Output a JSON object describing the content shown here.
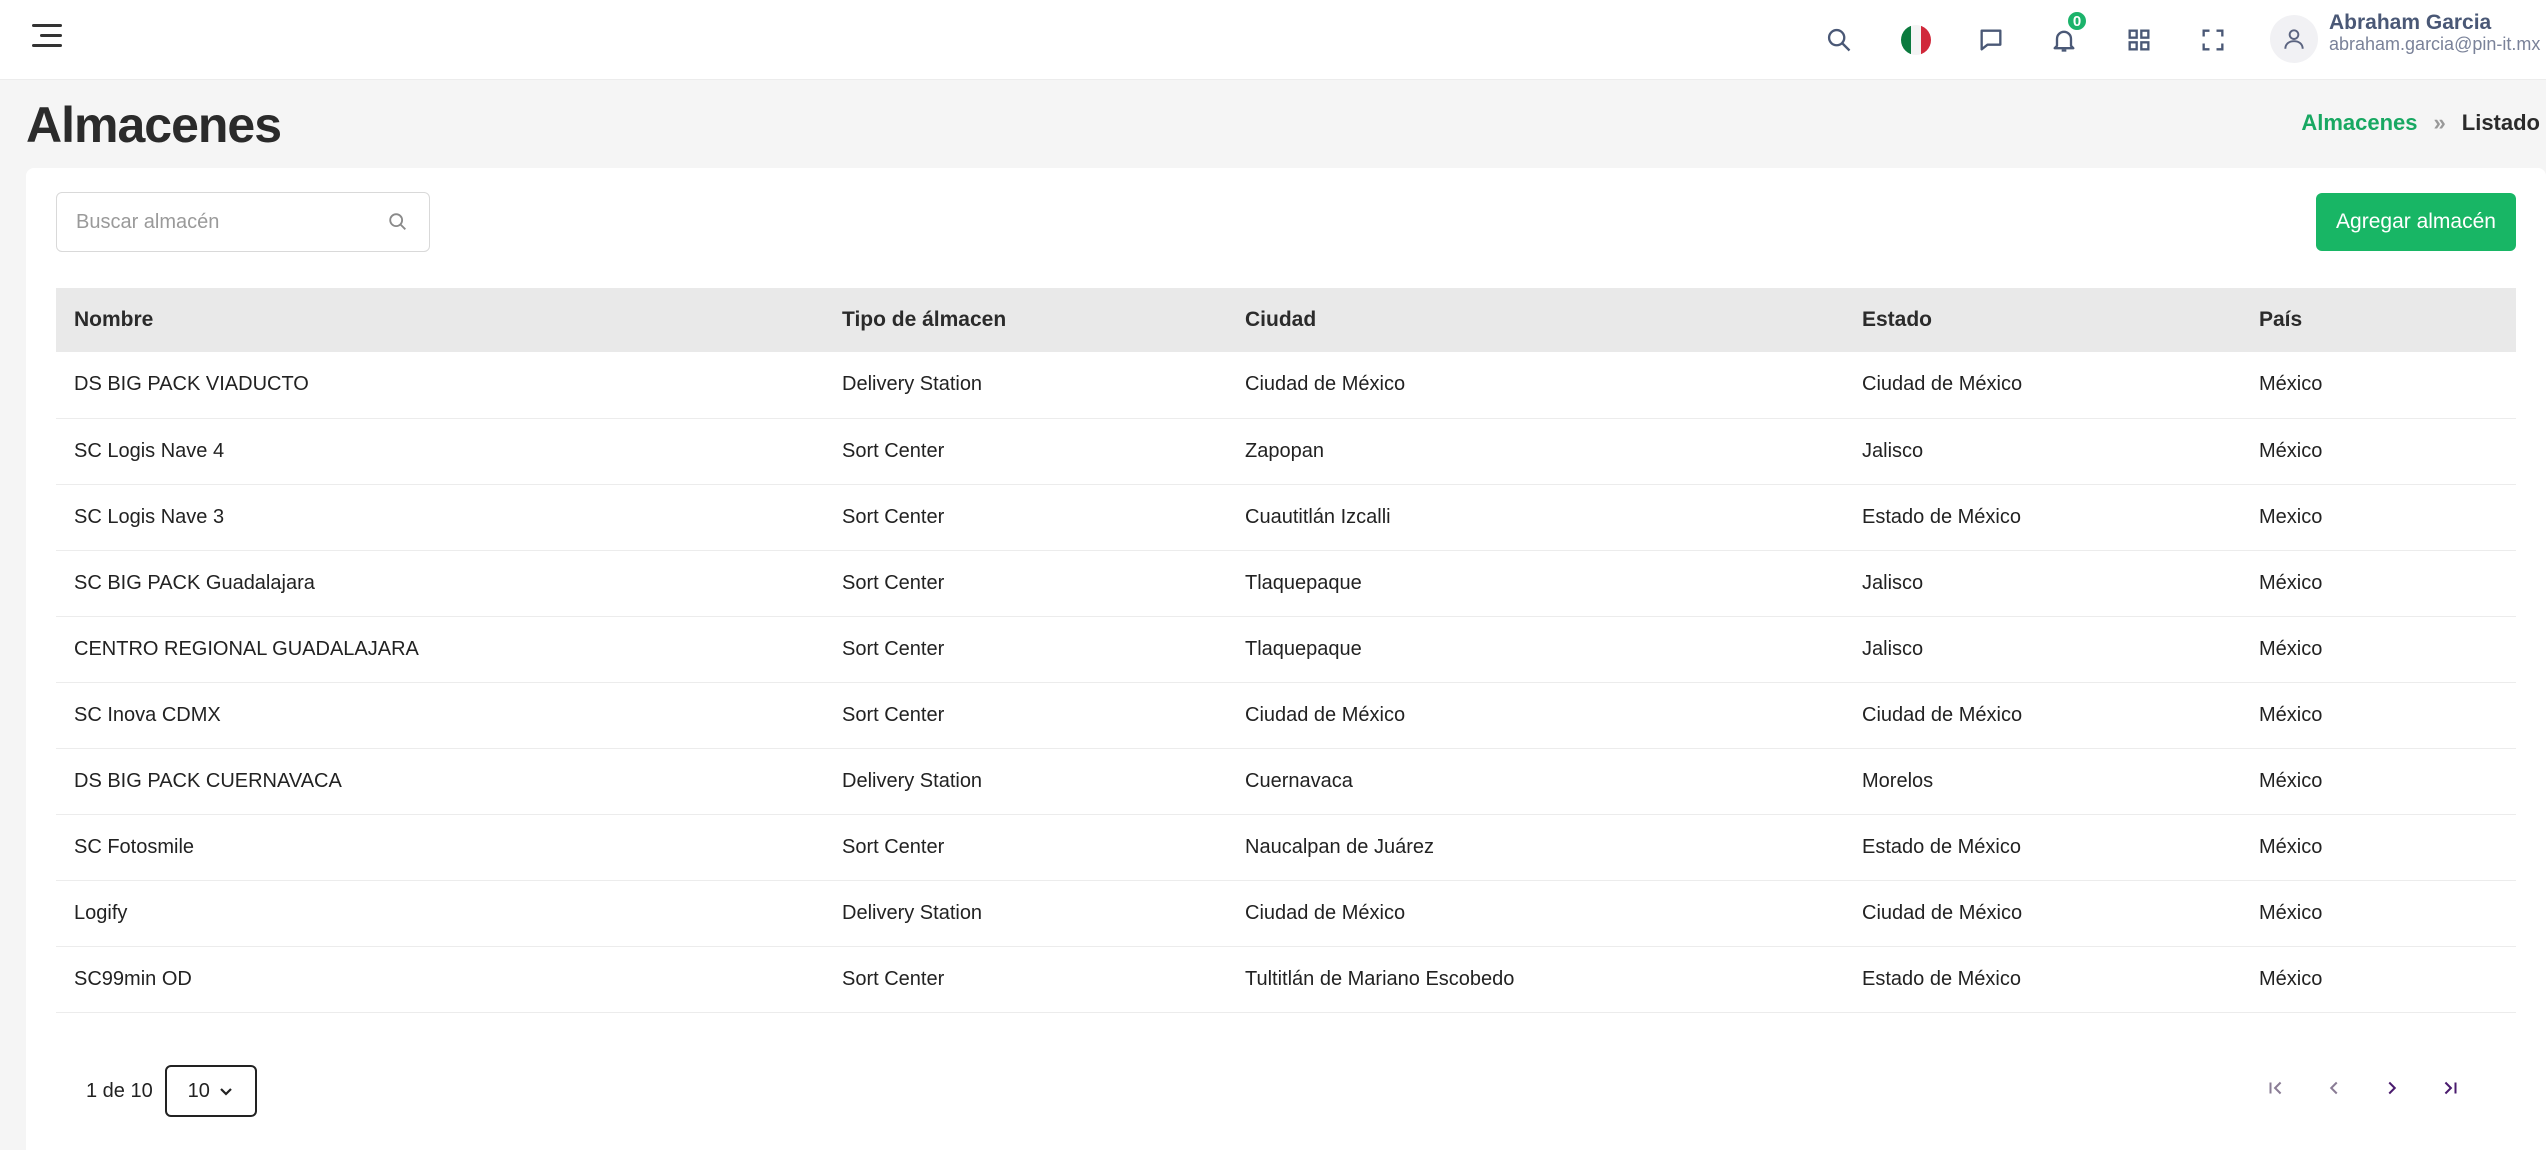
{
  "header": {
    "notifications_count": "0",
    "user_name": "Abraham Garcia",
    "user_email": "abraham.garcia@pin-it.mx",
    "icons": [
      "menu-icon",
      "search-icon",
      "mexico-flag-icon",
      "chat-icon",
      "bell-icon",
      "apps-grid-icon",
      "fullscreen-icon",
      "user-icon"
    ]
  },
  "page": {
    "title": "Almacenes",
    "breadcrumb": {
      "link": "Almacenes",
      "current": "Listado"
    }
  },
  "toolbar": {
    "search_placeholder": "Buscar almacén",
    "add_button": "Agregar almacén"
  },
  "table": {
    "columns": [
      "Nombre",
      "Tipo de álmacen",
      "Ciudad",
      "Estado",
      "País"
    ],
    "rows": [
      [
        "DS BIG PACK VIADUCTO",
        "Delivery Station",
        "Ciudad de México",
        "Ciudad de México",
        "México"
      ],
      [
        "SC Logis Nave 4",
        "Sort Center",
        "Zapopan",
        "Jalisco",
        "México"
      ],
      [
        "SC Logis Nave 3",
        "Sort Center",
        "Cuautitlán Izcalli",
        "Estado de México",
        "Mexico"
      ],
      [
        "SC BIG PACK Guadalajara",
        "Sort Center",
        "Tlaquepaque",
        "Jalisco",
        "México"
      ],
      [
        "CENTRO REGIONAL GUADALAJARA",
        "Sort Center",
        "Tlaquepaque",
        "Jalisco",
        "México"
      ],
      [
        "SC Inova CDMX",
        "Sort Center",
        "Ciudad de México",
        "Ciudad de México",
        "México"
      ],
      [
        "DS BIG PACK CUERNAVACA",
        "Delivery Station",
        "Cuernavaca",
        "Morelos",
        "México"
      ],
      [
        "SC Fotosmile",
        "Sort Center",
        "Naucalpan de Juárez",
        "Estado de México",
        "México"
      ],
      [
        "Logify",
        "Delivery Station",
        "Ciudad de México",
        "Ciudad de México",
        "México"
      ],
      [
        "SC99min OD",
        "Sort Center",
        "Tultitlán de Mariano Escobedo",
        "Estado de México",
        "México"
      ]
    ]
  },
  "pagination": {
    "page_text": "1 de 10",
    "per_page": "10"
  },
  "colors": {
    "accent": "#18b665",
    "badge": "#1cb36b",
    "header_row": "#e9e9e9"
  }
}
